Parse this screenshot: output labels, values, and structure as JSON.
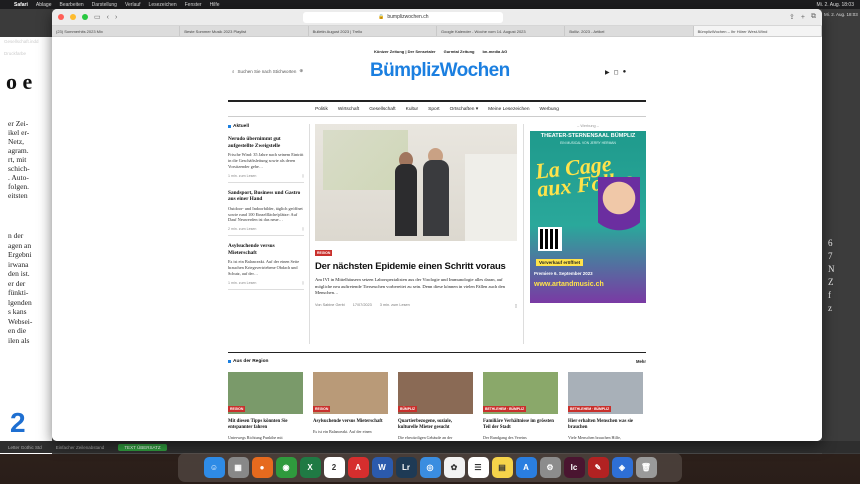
{
  "menubar": {
    "app_name": "Safari",
    "items": [
      "Ablage",
      "Bearbeiten",
      "Darstellung",
      "Verlauf",
      "Lesezeichen",
      "Fenster",
      "Hilfe"
    ],
    "clock": "Mi. 2. Aug. 18:03"
  },
  "background_app": {
    "tab_label": "Gesellschaft.indd",
    "panel_label": "Druckfarbe",
    "big_text": "o e",
    "body_lines": [
      "er Zei-",
      "ikel er-",
      "Netz,",
      "agram.",
      "rt, mit",
      "schich-",
      ". Auto-",
      "folgen.",
      "eitsten"
    ],
    "body_lines_2": [
      "n der",
      "agen an",
      "Ergebni",
      "irwana",
      "den ist.",
      "er der",
      "fünkti-",
      "lgenden",
      "s kans",
      "Websei-",
      "en die",
      "ilen als"
    ],
    "big_number": "2",
    "glyphs": [
      "6",
      "7",
      "N",
      "Z",
      "f",
      "z"
    ],
    "status_left": "Letter Gothic Std",
    "status_mid": "Einfacher Zeilenabstand",
    "status_ok": "TEXT ÜBERSATZ"
  },
  "browser": {
    "url": "bumplizwochen.ch",
    "tabs": [
      "(23) Sommerhits 2023 Mix",
      "Beste Sommer Musik 2023 Playlist",
      "Bulletin August 2023 | Trello",
      "Google Kalender - Woche vom 14. August 2023",
      "Bolliz. 2023 - Artikel",
      "BümplizWochen – Ihr Hörer West-Wind"
    ]
  },
  "site": {
    "top_links": [
      "Könizer Zeitung | Der Sensetaler",
      "Gurmtal Zeitung",
      "bn-media AG"
    ],
    "search_placeholder": "Suchen Sie nach Stichworten",
    "logo": "BümplizWochen",
    "nav": [
      "Politik",
      "Wirtschaft",
      "Gesellschaft",
      "Kultur",
      "Sport",
      "Ortschaften ▾",
      "Meine Lesezeichen",
      "Werbung"
    ],
    "aktuell": {
      "heading": "Aktuell",
      "items": [
        {
          "title": "Nerudo übernimmt gut aufgestellte Zweigstelle",
          "teaser": "Frische Wind: 35 Jahre nach seinem Eintritt in die Geschäftsleitung sowie als deren Vorsitzender gehe…",
          "meta": "1 min. zum Lesen"
        },
        {
          "title": "Sandsport, Business und Gastro aus einer Hand",
          "teaser": "Outdoor- und Indoorbilder, täglich geöffnet sowie rund 100 Einzelfläche/plätze: Auf Dauf Neuwerden ist das neue…",
          "meta": "2 min. zum Lesen"
        },
        {
          "title": "Asylsuchende versus Mieterschaft",
          "teaser": "Es ist ein Balanceakt. Auf der einen Seite brauchen Kriegsvertriebene Obdach und Schutz, auf der…",
          "meta": "1 min. zum Lesen"
        }
      ]
    },
    "lead": {
      "tag": "REGION",
      "title": "Der nächsten Epidemie einen Schritt voraus",
      "teaser": "Am IVI in Mittelhäusern setzen Laborspezialisten aus der Virologie und Immunologie alles daran, auf mögliche neu auftretende Tierseuchen vorbereitet zu sein. Denn diese können in vielen Fällen auch den Menschen…",
      "author": "Von Sabine Gerbi",
      "date": "17/07/2023",
      "read_time": "3 min. zum Lesen"
    },
    "ad": {
      "label": "– Werbung –",
      "header": "THEATER-STERNENSAAL BÜMPLIZ",
      "sub": "EIN MUSICAL VON JERRY HERMAN",
      "show": "La Cage aux Folles",
      "presale": "Vorverkauf eröffnet",
      "premiere": "Premiere 6. September 2023",
      "url": "www.artandmusic.ch"
    },
    "region": {
      "heading": "Aus der Region",
      "more": "Mehr",
      "items": [
        {
          "tag": "REGION",
          "title": "Mit diesen Tipps könnten Sie entspannter fahren",
          "teaser": "Unterwegs Richtung Punkthe mit",
          "color": "#7a9a6a"
        },
        {
          "tag": "REGION",
          "title": "Asylsuchende versus Mieterschaft",
          "teaser": "Es ist ein Balanceakt. Auf der einen",
          "color": "#b99a78"
        },
        {
          "tag": "BÜMPLIZ",
          "title": "Quartierbezogene, soziale, kulturelle Mieter gesucht",
          "teaser": "Die ehrwürdigen Gebäude an der",
          "color": "#8a6a55"
        },
        {
          "tag": "BETHLEHEM · BÜMPLIZ",
          "title": "Familiäre Verhältnisse im grössten Teil der Stadt",
          "teaser": "Der Rundgang des Vereins",
          "color": "#8aa86a"
        },
        {
          "tag": "BETHLEHEM · BÜMPLIZ",
          "title": "Hier erhalten Menschen was sie brauchen",
          "teaser": "Viele Menschen brauchen Hilfe,",
          "color": "#a8b0b8"
        }
      ]
    }
  },
  "dock": {
    "apps": [
      {
        "name": "finder",
        "color": "#2e8be6",
        "glyph": "☺"
      },
      {
        "name": "launchpad",
        "color": "#888888",
        "glyph": "▦"
      },
      {
        "name": "firefox",
        "color": "#e66a1e",
        "glyph": "●"
      },
      {
        "name": "chrome",
        "color": "#2f9a3d",
        "glyph": "◉"
      },
      {
        "name": "excel",
        "color": "#1f7a44",
        "glyph": "X"
      },
      {
        "name": "calendar",
        "color": "#ffffff",
        "glyph": "2"
      },
      {
        "name": "acrobat",
        "color": "#d62e2e",
        "glyph": "A"
      },
      {
        "name": "word",
        "color": "#2b5aad",
        "glyph": "W"
      },
      {
        "name": "lightroom",
        "color": "#1e3a55",
        "glyph": "Lr"
      },
      {
        "name": "safari",
        "color": "#3a8de0",
        "glyph": "◎"
      },
      {
        "name": "photos",
        "color": "#f2f2f2",
        "glyph": "✿"
      },
      {
        "name": "reminders",
        "color": "#ffffff",
        "glyph": "☰"
      },
      {
        "name": "notes",
        "color": "#f5d34a",
        "glyph": "▤"
      },
      {
        "name": "appstore",
        "color": "#2a7ee0",
        "glyph": "A"
      },
      {
        "name": "settings",
        "color": "#8c8c8c",
        "glyph": "⚙"
      },
      {
        "name": "indesign",
        "color": "#4a1530",
        "glyph": "Ic"
      },
      {
        "name": "acrobat2",
        "color": "#b22222",
        "glyph": "✎"
      },
      {
        "name": "appstore2",
        "color": "#2e6fd6",
        "glyph": "◈"
      },
      {
        "name": "trash",
        "color": "#9a9a9a",
        "glyph": "🗑"
      }
    ]
  }
}
